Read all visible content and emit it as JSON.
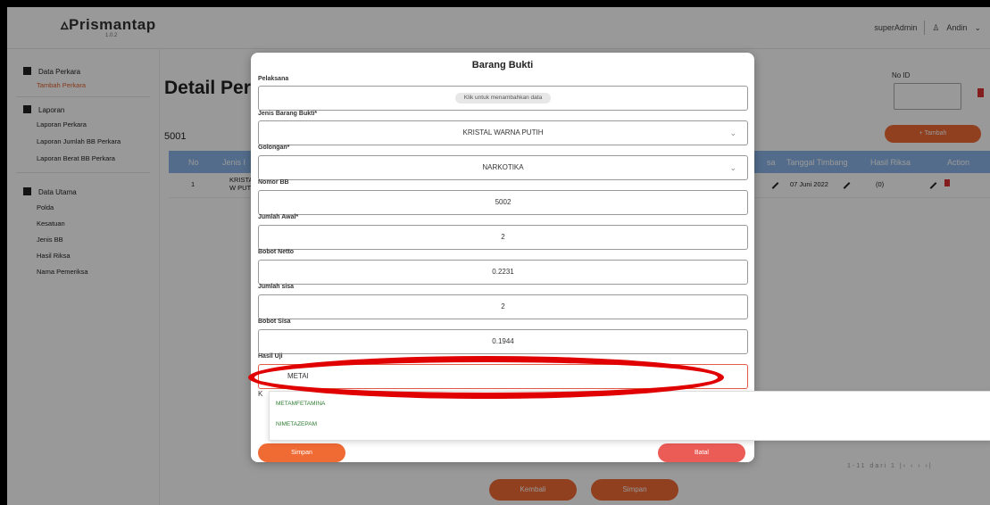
{
  "app": {
    "logo": "Prismantap",
    "logo_sub": "1.0.2"
  },
  "header": {
    "role": "superAdmin",
    "user": "Andin"
  },
  "sidebar": {
    "group1": "Data Perkara",
    "item_tambah": "Tambah Perkara",
    "group2": "Laporan",
    "item_lap_perkara": "Laporan Perkara",
    "item_lap_jumlah": "Laporan Jumlah BB Perkara",
    "item_lap_berat": "Laporan Berat BB Perkara",
    "group3": "Data Utama",
    "item_polda": "Polda",
    "item_kesatuan": "Kesatuan",
    "item_jenis": "Jenis BB",
    "item_hasil": "Hasil Riksa",
    "item_nama": "Nama Pemeriksa"
  },
  "page": {
    "title": "Detail Perk",
    "number": "5001",
    "noid_label": "No ID",
    "tambah_label": "+ Tambah"
  },
  "table": {
    "headers": {
      "no": "No",
      "jenis": "Jenis I",
      "sa": "sa",
      "tanggal": "Tanggal Timbang",
      "hasil": "Hasil Riksa",
      "action": "Action"
    },
    "row": {
      "no": "1",
      "jenis": "KRISTAL W PUTI",
      "tanggal": "07 Juni 2022",
      "hasil": "(0)"
    }
  },
  "pagination": "1-11 dari 1   |‹   ‹   ›   ›|",
  "bottom_buttons": {
    "kembali": "Kembali",
    "simpan": "Simpan"
  },
  "modal": {
    "title": "Barang Bukti",
    "pelaksana_label": "Pelaksana",
    "pelaksana_chip": "Klik untuk menambahkan data",
    "jenis_label": "Jenis Barang Bukti*",
    "jenis_value": "KRISTAL WARNA PUTIH",
    "golongan_label": "Golongan*",
    "golongan_value": "NARKOTIKA",
    "nomor_label": "Nomor BB",
    "nomor_value": "5002",
    "jumlah_label": "Jumlah Awal*",
    "jumlah_value": "2",
    "netto_label": "Bobot Netto",
    "netto_value": "0.2231",
    "sisa_label": "Jumlah sisa",
    "sisa_value": "2",
    "bobot_sisa_label": "Bobot Sisa",
    "bobot_sisa_value": "0.1944",
    "hasil_label": "Hasil Uji",
    "hasil_value": "METAl",
    "k_label": "K",
    "options": [
      "METAMFETAMINA",
      "NIMETAZEPAM"
    ],
    "save": "Simpan",
    "cancel": "Batal"
  }
}
